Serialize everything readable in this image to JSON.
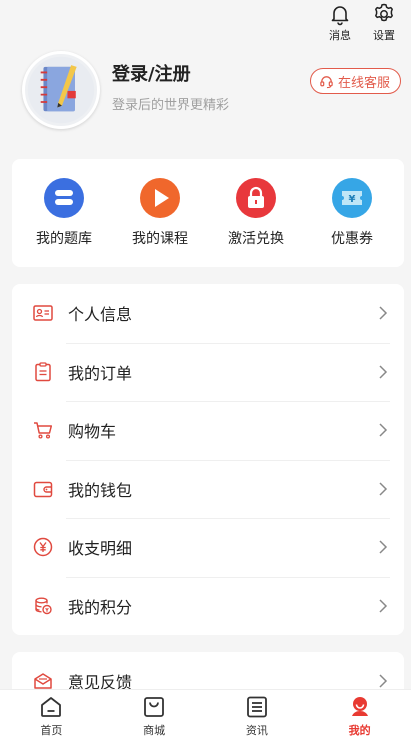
{
  "topbar": {
    "messages_label": "消息",
    "settings_label": "设置"
  },
  "profile": {
    "title": "登录/注册",
    "subtitle": "登录后的世界更精彩",
    "service_label": "在线客服"
  },
  "quick_actions": [
    {
      "label": "我的题库",
      "icon": "question-bank-icon",
      "color": "#3b6fe0"
    },
    {
      "label": "我的课程",
      "icon": "play-course-icon",
      "color": "#f0672c"
    },
    {
      "label": "激活兑换",
      "icon": "lock-activate-icon",
      "color": "#e8383c"
    },
    {
      "label": "优惠券",
      "icon": "coupon-icon",
      "color": "#36a6e6"
    }
  ],
  "menu": [
    {
      "label": "个人信息",
      "icon": "id-card-icon"
    },
    {
      "label": "我的订单",
      "icon": "clipboard-icon"
    },
    {
      "label": "购物车",
      "icon": "cart-icon"
    },
    {
      "label": "我的钱包",
      "icon": "wallet-icon"
    },
    {
      "label": "收支明细",
      "icon": "yen-icon"
    },
    {
      "label": "我的积分",
      "icon": "coins-icon"
    }
  ],
  "menu2": [
    {
      "label": "意见反馈",
      "icon": "feedback-icon"
    }
  ],
  "tabs": [
    {
      "label": "首页",
      "icon": "home-icon"
    },
    {
      "label": "商城",
      "icon": "shop-bag-icon"
    },
    {
      "label": "资讯",
      "icon": "news-icon"
    },
    {
      "label": "我的",
      "icon": "profile-icon",
      "active": true
    }
  ],
  "colors": {
    "accent": "#e83a32",
    "icon_red": "#e0493f",
    "background": "#f5f5f5"
  }
}
